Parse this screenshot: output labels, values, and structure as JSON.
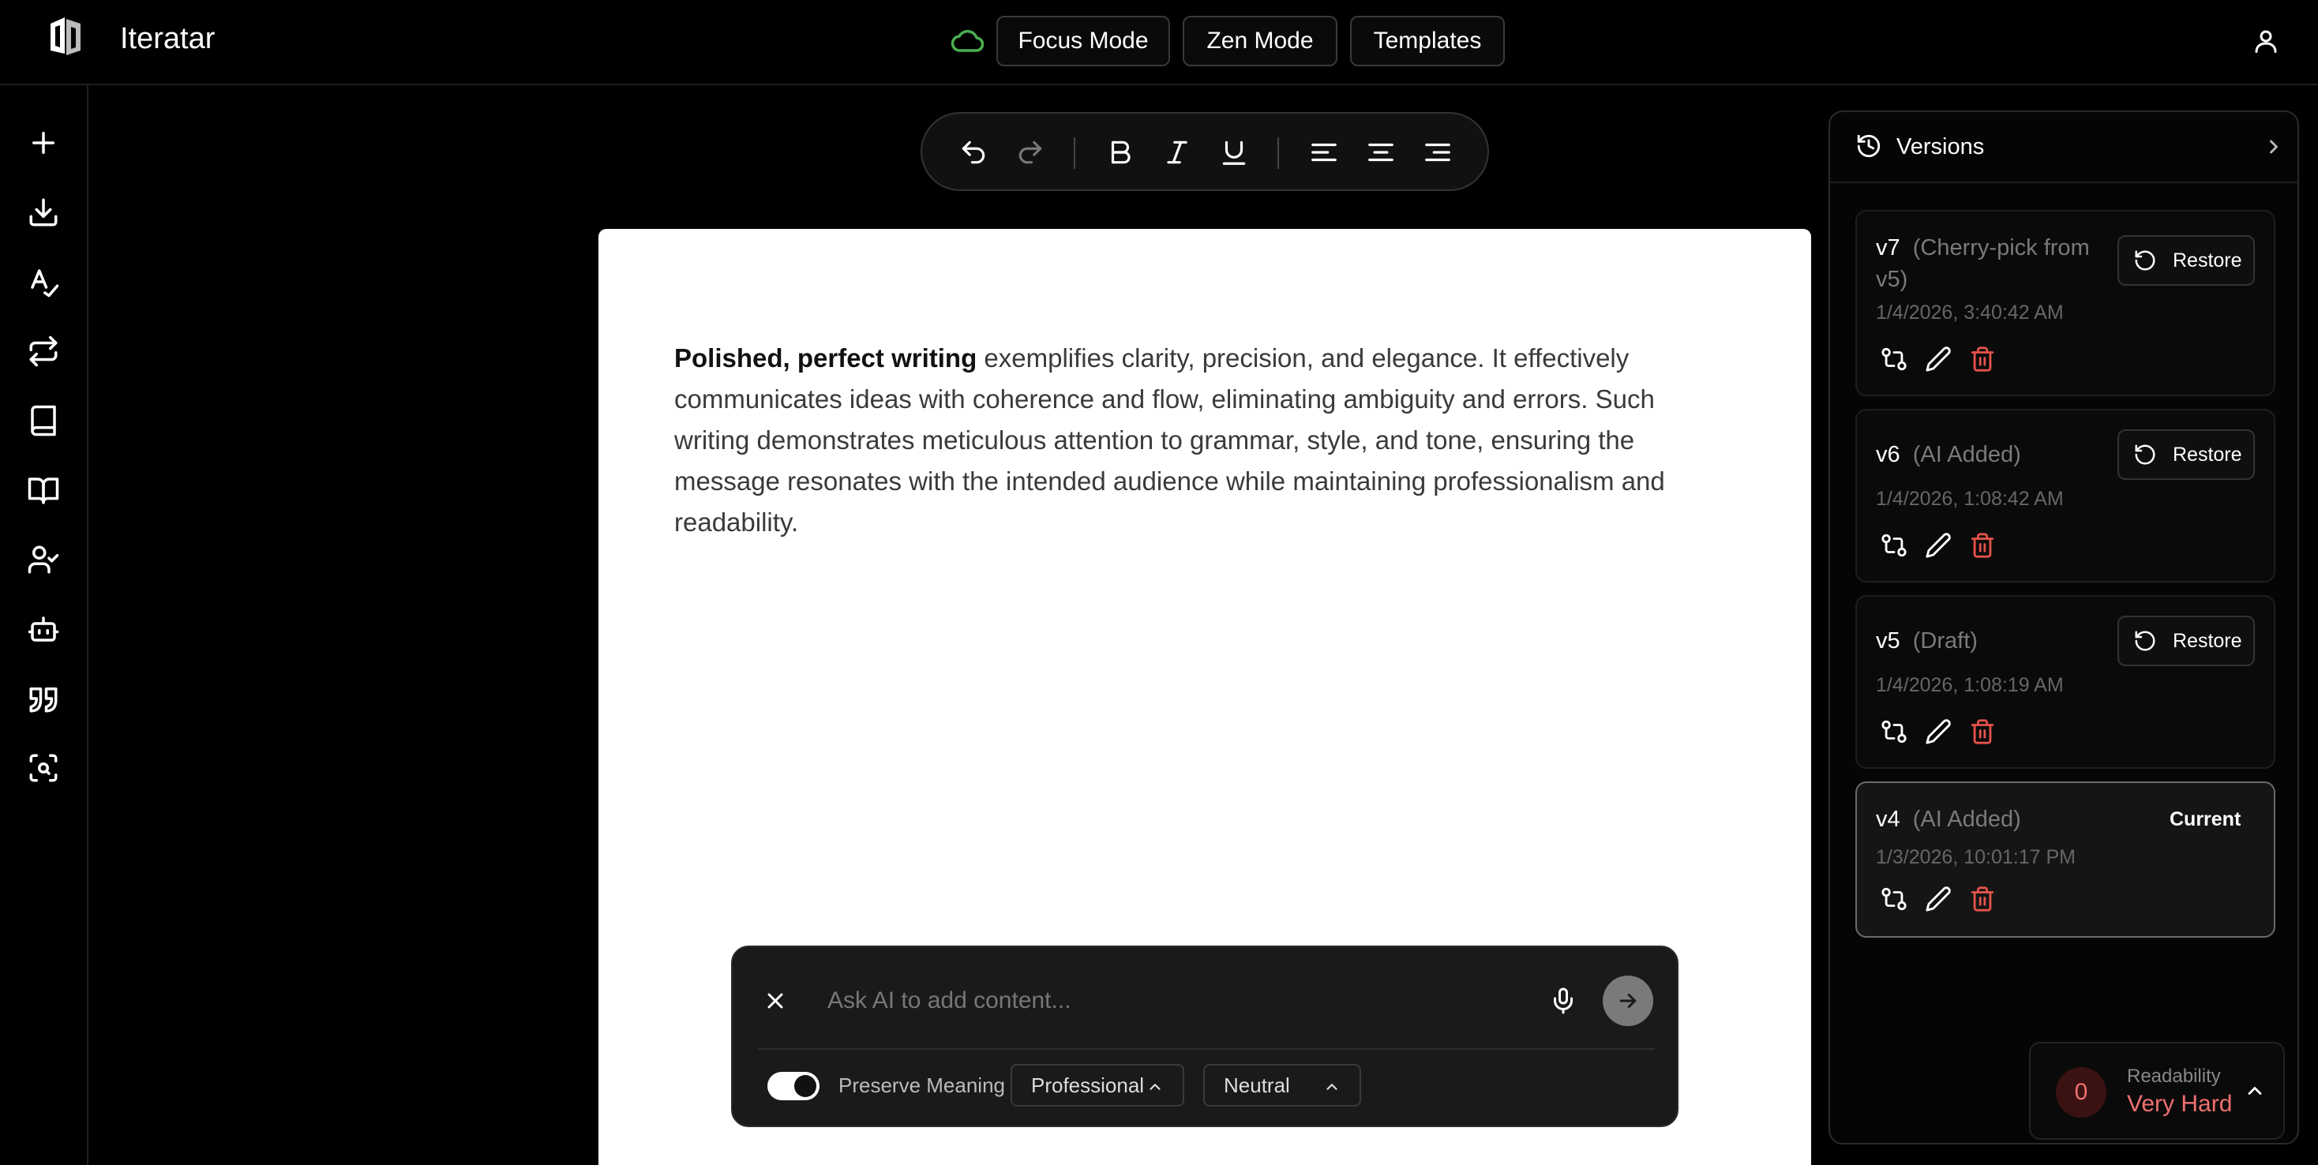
{
  "header": {
    "app_title": "Iteratar",
    "buttons": [
      "Focus Mode",
      "Zen Mode",
      "Templates"
    ]
  },
  "sidebar": {
    "icons": [
      "plus-icon",
      "download-icon",
      "spellcheck-icon",
      "repeat-icon",
      "book-icon",
      "book-open-icon",
      "user-check-icon",
      "bot-icon",
      "quote-icon",
      "scan-search-icon"
    ]
  },
  "editor": {
    "bold_text": "Polished, perfect writing",
    "body_text": " exemplifies clarity, precision, and elegance. It effectively communicates ideas with coherence and flow, eliminating ambiguity and errors. Such writing demonstrates meticulous attention to grammar, style, and tone, ensuring the message resonates with the intended audience while maintaining professionalism and readability."
  },
  "ai_panel": {
    "placeholder": "Ask AI to add content...",
    "preserve_label": "Preserve Meaning",
    "preserve_on": true,
    "tone_value": "Professional",
    "style_value": "Neutral"
  },
  "versions": {
    "title": "Versions",
    "restore_label": "Restore",
    "current_label": "Current",
    "items": [
      {
        "name": "v7",
        "desc_line1": "(Cherry-pick from",
        "desc_line2": "v5)",
        "time": "1/4/2026, 3:40:42 AM"
      },
      {
        "name": "v6",
        "desc": "(AI Added)",
        "time": "1/4/2026, 1:08:42 AM"
      },
      {
        "name": "v5",
        "desc": "(Draft)",
        "time": "1/4/2026, 1:08:19 AM"
      },
      {
        "name": "v4",
        "desc": "(AI Added)",
        "time": "1/3/2026, 10:01:17 PM"
      }
    ]
  },
  "readability": {
    "score": "0",
    "label": "Readability",
    "value": "Very Hard"
  },
  "colors": {
    "accent_green": "#4caf50",
    "danger_red": "#e5534b",
    "readability_red": "#f07070"
  }
}
